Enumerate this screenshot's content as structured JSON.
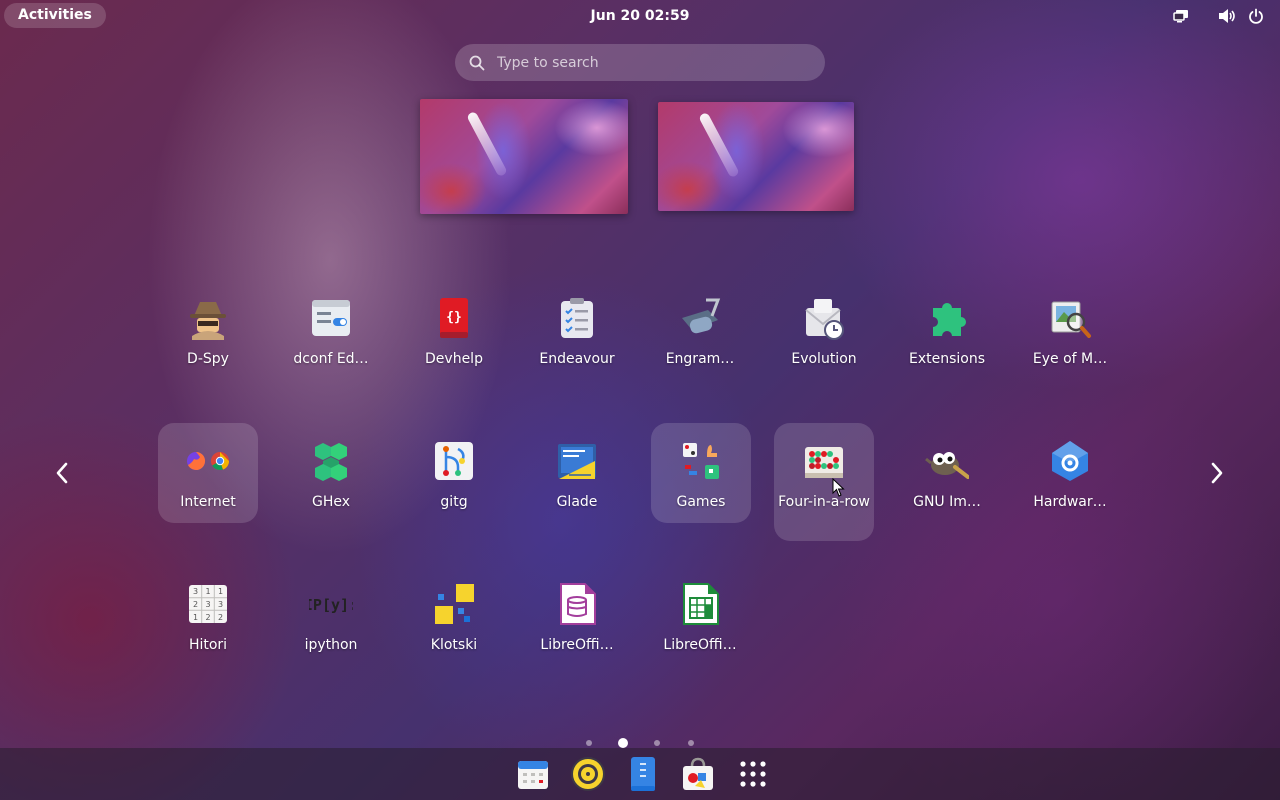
{
  "topbar": {
    "activities_label": "Activities",
    "clock": "Jun 20  02:59",
    "tray_icons": [
      "display-icon",
      "volume-icon",
      "power-icon"
    ]
  },
  "search": {
    "placeholder": "Type to search"
  },
  "workspaces": [
    "workspace-1",
    "workspace-2"
  ],
  "apps": {
    "row1": [
      "D-Spy",
      "dconf Ed…",
      "Devhelp",
      "Endeavour",
      "Engram…",
      "Evolution",
      "Extensions",
      "Eye of M…"
    ],
    "row2": [
      "Internet",
      "GHex",
      "gitg",
      "Glade",
      "Games",
      "Four-in-a-row",
      "GNU Im…",
      "Hardwar…"
    ],
    "row3": [
      "Hitori",
      "ipython",
      "Klotski",
      "LibreOffi…",
      "LibreOffi…"
    ]
  },
  "pagination": {
    "pages": 4,
    "current": 2
  },
  "dash": {
    "items": [
      "calendar",
      "rhythmbox",
      "text-editor",
      "software",
      "show-apps"
    ]
  },
  "colors": {
    "panel_bg": "#00000000",
    "highlight": "#ffffff26",
    "firefox": "#e66000",
    "chrome_red": "#db4437",
    "chrome_green": "#0f9d58",
    "chrome_yellow": "#f4b400",
    "ghex_green": "#2ec27e",
    "extensions_green": "#33d17a",
    "devhelp_red": "#e01b24"
  }
}
